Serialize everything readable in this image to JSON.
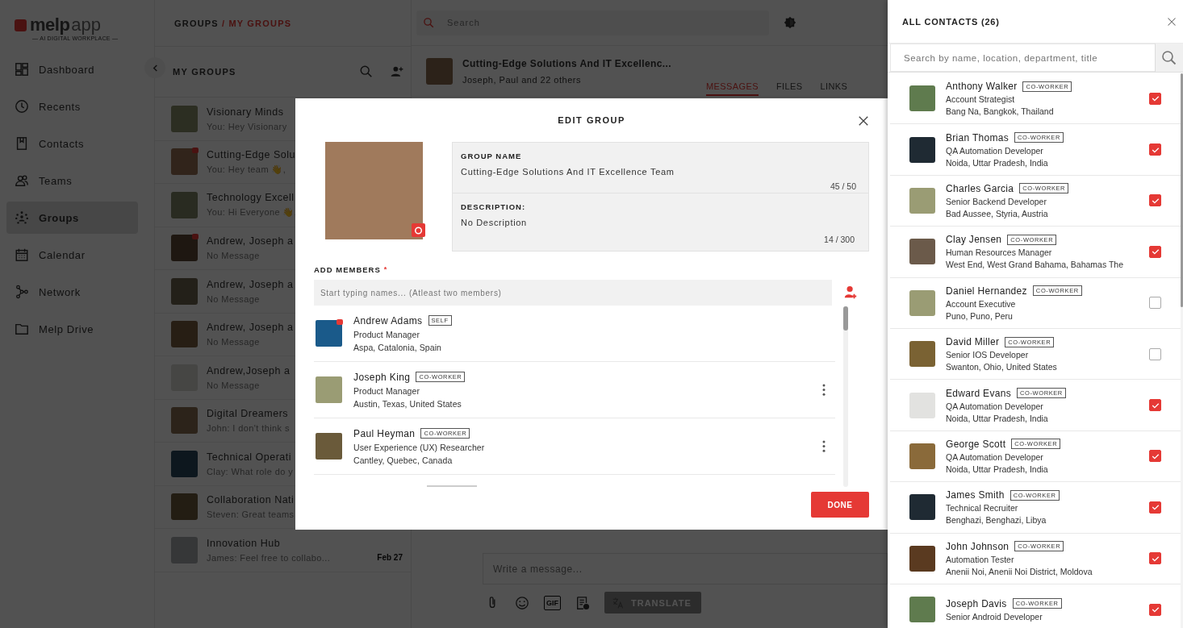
{
  "logo": {
    "name": "melp",
    "suffix": "app",
    "tagline": "— AI DIGITAL WORKPLACE —"
  },
  "sidebar": {
    "items": [
      {
        "label": "Dashboard",
        "kind": "dashboard",
        "selected": false
      },
      {
        "label": "Recents",
        "kind": "recents",
        "selected": false
      },
      {
        "label": "Contacts",
        "kind": "contacts",
        "selected": false
      },
      {
        "label": "Teams",
        "kind": "teams",
        "selected": false
      },
      {
        "label": "Groups",
        "kind": "groups",
        "selected": true
      },
      {
        "label": "Calendar",
        "kind": "calendar",
        "selected": false
      },
      {
        "label": "Network",
        "kind": "network",
        "selected": false
      },
      {
        "label": "Melp Drive",
        "kind": "drive",
        "selected": false
      }
    ]
  },
  "breadcrumb": {
    "parent": "GROUPS",
    "current": "/ MY GROUPS"
  },
  "groups_panel": {
    "title": "MY GROUPS",
    "items": [
      {
        "name": "Visionary Minds",
        "preview": "You: Hey Visionary",
        "badge": false
      },
      {
        "name": "Cutting-Edge Solu",
        "preview": "You: Hey team 👋,",
        "badge": true
      },
      {
        "name": "Technology Excell",
        "preview": "You: Hi Everyone 👋,",
        "badge": false
      },
      {
        "name": "Andrew, Joseph a",
        "preview": "No Message",
        "badge": true
      },
      {
        "name": "Andrew, Joseph a",
        "preview": "No Message",
        "badge": false
      },
      {
        "name": "Andrew, Joseph a",
        "preview": "No Message",
        "badge": false
      },
      {
        "name": "Andrew,Joseph a",
        "preview": "No Message",
        "badge": false
      },
      {
        "name": "Digital Dreamers",
        "preview": "John: I don't think s",
        "badge": false
      },
      {
        "name": "Technical Operati",
        "preview": "Clay: What role do y",
        "badge": false
      },
      {
        "name": "Collaboration Nati",
        "preview": "Steven: Great teams",
        "badge": false
      },
      {
        "name": "Innovation Hub",
        "preview": "James: Feel free to collabo...",
        "time": "Feb 27",
        "badge": false
      }
    ]
  },
  "search": {
    "placeholder": "Search"
  },
  "chat": {
    "title": "Cutting-Edge Solutions And IT Excellenc...",
    "subtitle": "Joseph, Paul and 22 others",
    "tabs": [
      {
        "label": "MESSAGES",
        "selected": true
      },
      {
        "label": "FILES",
        "selected": false
      },
      {
        "label": "LINKS",
        "selected": false
      }
    ]
  },
  "composer": {
    "placeholder": "Write a message...",
    "gif": "GIF",
    "translate": "TRANSLATE"
  },
  "modal": {
    "title": "EDIT GROUP",
    "group_name": {
      "label": "GROUP NAME",
      "value": "Cutting-Edge Solutions And IT Excellence Team",
      "counter": "45 / 50"
    },
    "description": {
      "label": "DESCRIPTION:",
      "value": "No Description",
      "counter": "14 / 300"
    },
    "members_label": "ADD MEMBERS",
    "required_mark": "*",
    "members_field": {
      "placeholder": "Start typing names... (Atleast two members)"
    },
    "members": [
      {
        "name": "Andrew Adams",
        "kind": "self",
        "tag": "SELF",
        "title": "Product Manager",
        "location": "Aspa, Catalonia, Spain",
        "badge": true
      },
      {
        "name": "Joseph King",
        "kind": "coworker",
        "tag": "CO-WORKER",
        "title": "Product Manager",
        "location": "Austin, Texas, United States",
        "badge": false
      },
      {
        "name": "Paul Heyman",
        "kind": "coworker",
        "tag": "CO-WORKER",
        "title": "User Experience (UX) Researcher",
        "location": "Cantley, Quebec, Canada",
        "badge": false
      }
    ],
    "done": "DONE"
  },
  "contacts_drawer": {
    "title": "ALL CONTACTS (26)",
    "search": {
      "placeholder": "Search by name, location, department, title"
    },
    "contacts": [
      {
        "name": "Anthony Walker",
        "tag": "CO-WORKER",
        "title": "Account Strategist",
        "location": "Bang Na, Bangkok, Thailand",
        "checked": true
      },
      {
        "name": "Brian Thomas",
        "tag": "CO-WORKER",
        "title": "QA Automation Developer",
        "location": "Noida, Uttar Pradesh, India",
        "checked": true
      },
      {
        "name": "Charles Garcia",
        "tag": "CO-WORKER",
        "title": "Senior Backend Developer",
        "location": "Bad Aussee, Styria, Austria",
        "checked": true
      },
      {
        "name": "Clay Jensen",
        "tag": "CO-WORKER",
        "title": "Human Resources Manager",
        "location": "West End, West Grand Bahama, Bahamas The",
        "checked": true
      },
      {
        "name": "Daniel Hernandez",
        "tag": "CO-WORKER",
        "title": "Account Executive",
        "location": "Puno, Puno, Peru",
        "checked": false
      },
      {
        "name": "David Miller",
        "tag": "CO-WORKER",
        "title": "Senior IOS Developer",
        "location": "Swanton, Ohio, United States",
        "checked": false
      },
      {
        "name": "Edward Evans",
        "tag": "CO-WORKER",
        "title": "QA Automation Developer",
        "location": "Noida, Uttar Pradesh, India",
        "checked": true
      },
      {
        "name": "George Scott",
        "tag": "CO-WORKER",
        "title": "QA Automation Developer",
        "location": "Noida, Uttar Pradesh, India",
        "checked": true
      },
      {
        "name": "James Smith",
        "tag": "CO-WORKER",
        "title": "Technical Recruiter",
        "location": "Benghazi, Benghazi, Libya",
        "checked": true
      },
      {
        "name": "John Johnson",
        "tag": "CO-WORKER",
        "title": "Automation Tester",
        "location": "Anenii Noi, Anenii Noi District, Moldova",
        "checked": true
      },
      {
        "name": "Joseph Davis",
        "tag": "CO-WORKER",
        "title": "Senior Android Developer",
        "checked": true
      }
    ]
  }
}
